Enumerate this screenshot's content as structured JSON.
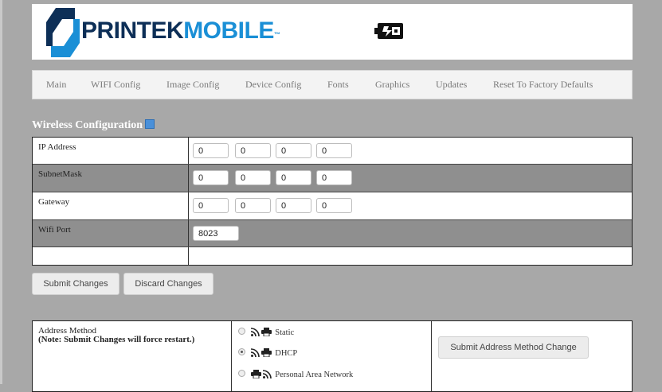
{
  "brand": {
    "logo_text_part1": "PRINTEK",
    "logo_text_part2": "MOBILE",
    "trademark": "™",
    "status_icon": "battery-charging-icon"
  },
  "nav": {
    "items": [
      {
        "label": "Main"
      },
      {
        "label": "WIFI Config"
      },
      {
        "label": "Image Config"
      },
      {
        "label": "Device Config"
      },
      {
        "label": "Fonts"
      },
      {
        "label": "Graphics"
      },
      {
        "label": "Updates"
      },
      {
        "label": "Reset To Factory Defaults"
      }
    ]
  },
  "wireless": {
    "title": "Wireless Configuration",
    "help_icon": "help-book-icon",
    "rows": [
      {
        "label": "IP Address",
        "octets": [
          "0",
          "0",
          "0",
          "0"
        ]
      },
      {
        "label": "SubnetMask",
        "octets": [
          "0",
          "0",
          "0",
          "0"
        ]
      },
      {
        "label": "Gateway",
        "octets": [
          "0",
          "0",
          "0",
          "0"
        ]
      },
      {
        "label": "Wifi Port",
        "value": "8023"
      }
    ]
  },
  "actions": {
    "submit_label": "Submit Changes",
    "discard_label": "Discard Changes"
  },
  "address_method": {
    "label_line1": "Address Method",
    "label_line2": "(Note: Submit Changes will force restart.)",
    "options": [
      {
        "label": "Static",
        "selected": false
      },
      {
        "label": "DHCP",
        "selected": true
      },
      {
        "label": "Personal Area Network",
        "selected": false
      }
    ],
    "submit_label": "Submit Address Method Change"
  },
  "colors": {
    "page_background": "#a8a8a8",
    "brand_dark": "#0d2f57",
    "brand_accent": "#1a8fd6",
    "alt_row": "#8f8f8f"
  }
}
